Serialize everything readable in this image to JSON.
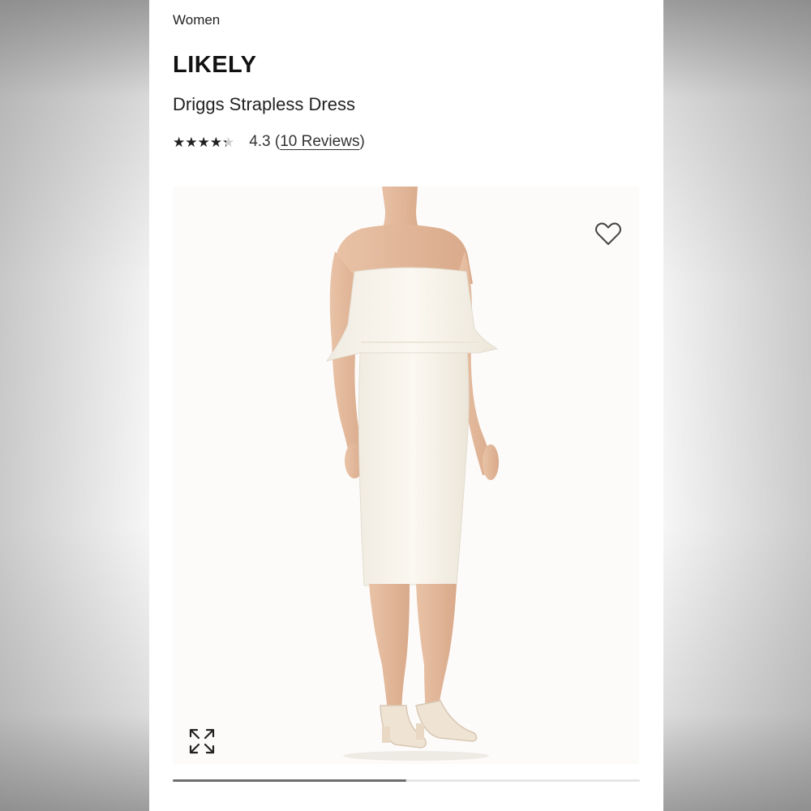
{
  "breadcrumb": {
    "category": "Women"
  },
  "product": {
    "brand": "LIKELY",
    "name": "Driggs Strapless Dress",
    "rating": {
      "stars_filled": 4.3,
      "stars_total": 5,
      "value_text": "4.3",
      "reviews_link": "10 Reviews"
    }
  },
  "gallery": {
    "favorite_icon": "heart-outline-icon",
    "expand_icon": "expand-arrows-icon",
    "progress_fraction": 0.5
  },
  "colors": {
    "background": "#ffffff",
    "text": "#222222",
    "progress": "#6f6f6f",
    "track": "#e6e6e6"
  }
}
